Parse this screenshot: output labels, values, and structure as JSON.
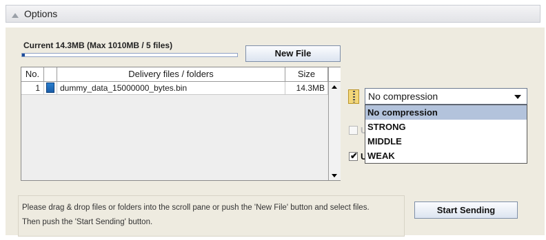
{
  "header": {
    "title": "Options"
  },
  "status": {
    "current_label": "Current 14.3MB (Max 1010MB / 5 files)",
    "progress_fraction": 0.014
  },
  "buttons": {
    "new_file": "New File",
    "start_sending": "Start Sending"
  },
  "table": {
    "columns": [
      "No.",
      "Delivery files / folders",
      "Size"
    ],
    "rows": [
      {
        "no": "1",
        "icon": "file-icon",
        "name": "dummy_data_15000000_bytes.bin",
        "size": "14.3MB"
      }
    ]
  },
  "compression": {
    "icon": "zip-archive-icon",
    "selected": "No compression",
    "options": [
      "No compression",
      "STRONG",
      "MIDDLE",
      "WEAK"
    ]
  },
  "checkboxes": [
    {
      "label": "U",
      "checked": false,
      "enabled": false
    },
    {
      "label": "U",
      "checked": true,
      "enabled": true
    }
  ],
  "instructions": {
    "line1": "Please drag & drop files or folders into the scroll pane or push the 'New File' button and select files.",
    "line2": "Then push the 'Start Sending' button."
  }
}
